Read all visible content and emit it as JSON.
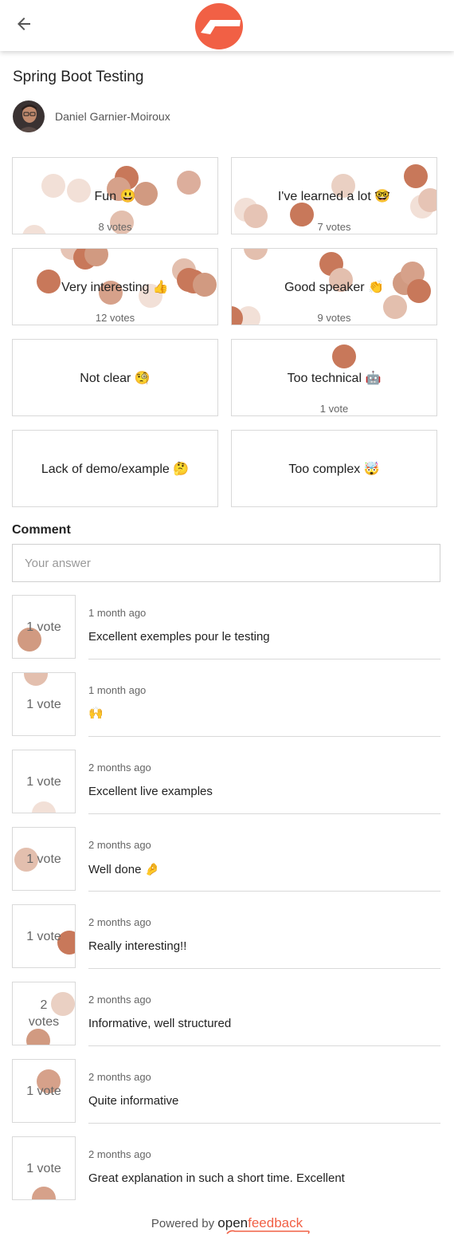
{
  "header": {
    "back_icon": "arrow-left-icon",
    "logo_icon": "openfeedback-logo-icon",
    "accent": "#f16045"
  },
  "talk": {
    "title": "Spring Boot Testing",
    "speaker": "Daniel Garnier-Moiroux"
  },
  "votes": [
    {
      "label": "Fun 😃",
      "count": "8 votes"
    },
    {
      "label": "I've learned a lot 🤓",
      "count": "7 votes"
    },
    {
      "label": "Very interesting 👍",
      "count": "12 votes"
    },
    {
      "label": "Good speaker 👏",
      "count": "9 votes"
    },
    {
      "label": "Not clear 🧐",
      "count": ""
    },
    {
      "label": "Too technical 🤖",
      "count": "1 vote"
    },
    {
      "label": "Lack of demo/example 🤔",
      "count": ""
    },
    {
      "label": "Too complex 🤯",
      "count": ""
    }
  ],
  "comment": {
    "heading": "Comment",
    "placeholder": "Your answer"
  },
  "comments": [
    {
      "votes": "1 vote",
      "time": "1 month ago",
      "text": "Excellent exemples pour le testing"
    },
    {
      "votes": "1 vote",
      "time": "1 month ago",
      "text": "🙌"
    },
    {
      "votes": "1 vote",
      "time": "2 months ago",
      "text": "Excellent live examples"
    },
    {
      "votes": "1 vote",
      "time": "2 months ago",
      "text": "Well done 🤌"
    },
    {
      "votes": "1 vote",
      "time": "2 months ago",
      "text": "Really interesting!!"
    },
    {
      "votes": "2 votes",
      "time": "2 months ago",
      "text": "Informative, well structured"
    },
    {
      "votes": "1 vote",
      "time": "2 months ago",
      "text": "Quite informative"
    },
    {
      "votes": "1 vote",
      "time": "2 months ago",
      "text": "Great explanation in such a short time. Excellent"
    }
  ],
  "footer": {
    "powered": "Powered by",
    "brand_a": "open",
    "brand_b": "feedback"
  }
}
